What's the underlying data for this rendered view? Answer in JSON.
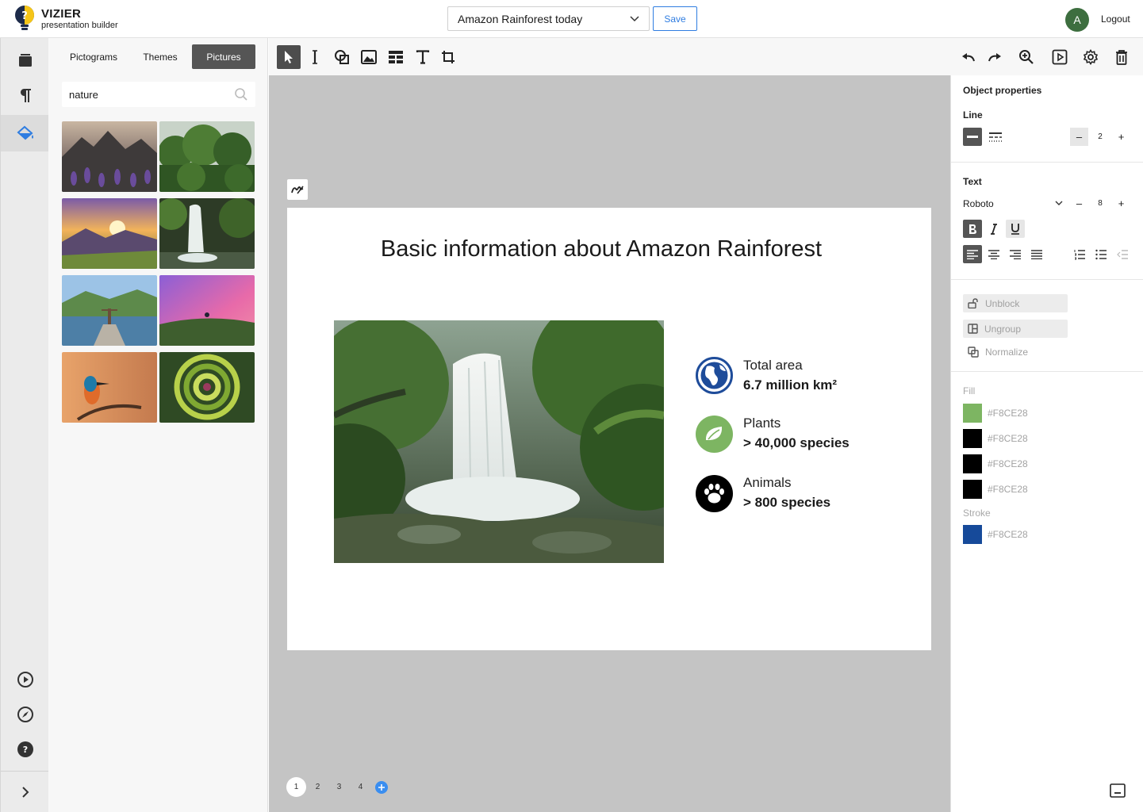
{
  "app": {
    "name": "VIZIER",
    "subtitle": "presentation builder"
  },
  "header": {
    "document_title": "Amazon Rainforest today",
    "save_label": "Save",
    "avatar_initial": "A",
    "logout_label": "Logout"
  },
  "left_rail": {
    "top_icons": [
      "layers-icon",
      "paragraph-icon",
      "paint-bucket-icon"
    ],
    "active": "paint-bucket-icon",
    "bottom_icons": [
      "play-circle-icon",
      "compass-icon",
      "help-icon"
    ],
    "expand_icon": "chevron-right-icon"
  },
  "library_panel": {
    "tabs": [
      {
        "label": "Pictograms"
      },
      {
        "label": "Themes"
      },
      {
        "label": "Pictures"
      }
    ],
    "active_tab": "Pictures",
    "search": {
      "value": "nature"
    },
    "pictures": [
      "purple-flowers-mountains",
      "forest-canopy",
      "mountain-sunrise",
      "waterfall-forest",
      "lake-person-dock",
      "pink-sky-hill",
      "kingfisher-bird",
      "spiral-succulent"
    ]
  },
  "toolbar": {
    "tools": [
      "select-tool",
      "line-tool",
      "shape-tool",
      "image-tool",
      "table-tool",
      "text-tool",
      "crop-tool"
    ],
    "active_tool": "select-tool",
    "actions": [
      "undo",
      "redo",
      "zoom-in",
      "preview",
      "settings",
      "delete"
    ]
  },
  "slide": {
    "title": "Basic information about Amazon Rainforest",
    "image": "waterfall-rainforest-photo",
    "facts": [
      {
        "icon": "globe-icon",
        "label": "Total area",
        "value": "6.7 million km²",
        "color": "#1E4C9A"
      },
      {
        "icon": "leaf-icon",
        "label": "Plants",
        "value": "> 40,000 species",
        "color": "#7DB562"
      },
      {
        "icon": "paw-icon",
        "label": "Animals",
        "value": "> 800 species",
        "color": "#000000"
      }
    ]
  },
  "pages": {
    "items": [
      "1",
      "2",
      "3",
      "4"
    ],
    "current": "1",
    "add_icon": "plus-circle-icon"
  },
  "properties": {
    "title": "Object properties",
    "line": {
      "heading": "Line",
      "width": "2"
    },
    "text": {
      "heading": "Text",
      "font": "Roboto",
      "size": "8"
    },
    "buttons": [
      {
        "label": "Unblock"
      },
      {
        "label": "Ungroup"
      },
      {
        "label": "Normalize"
      }
    ],
    "fill": {
      "label": "Fill",
      "items": [
        {
          "swatch": "#7DB562",
          "hex": "#F8CE28"
        },
        {
          "swatch": "#000000",
          "hex": "#F8CE28"
        },
        {
          "swatch": "#000000",
          "hex": "#F8CE28"
        },
        {
          "swatch": "#000000",
          "hex": "#F8CE28"
        }
      ]
    },
    "stroke": {
      "label": "Stroke",
      "items": [
        {
          "swatch": "#164A9A",
          "hex": "#F8CE28"
        }
      ]
    }
  }
}
